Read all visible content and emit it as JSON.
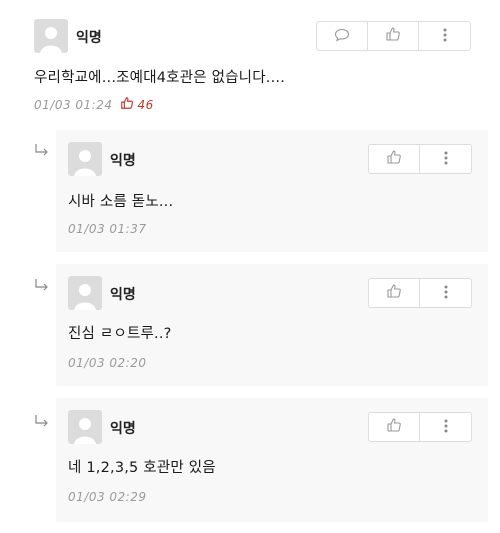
{
  "comments": [
    {
      "author": "익명",
      "text": "우리학교에...조예대4호관은 없습니다....",
      "timestamp": "01/03 01:24",
      "votes": "46",
      "actions": [
        "comment-icon",
        "thumbs-up-icon",
        "more-vertical-icon"
      ]
    }
  ],
  "replies": [
    {
      "author": "익명",
      "text": "시바 소름 돋노...",
      "timestamp": "01/03 01:37",
      "actions": [
        "thumbs-up-icon",
        "more-vertical-icon"
      ]
    },
    {
      "author": "익명",
      "text": "진심 ㄹㅇ트루..?",
      "timestamp": "01/03 02:20",
      "actions": [
        "thumbs-up-icon",
        "more-vertical-icon"
      ]
    },
    {
      "author": "익명",
      "text": "네 1,2,3,5 호관만 있음",
      "timestamp": "01/03 02:29",
      "actions": [
        "thumbs-up-icon",
        "more-vertical-icon"
      ]
    }
  ],
  "colors": {
    "vote": "#c0392b",
    "meta": "#9a9a9a",
    "reply_bg": "#f8f8f8",
    "border": "#dddddd"
  }
}
